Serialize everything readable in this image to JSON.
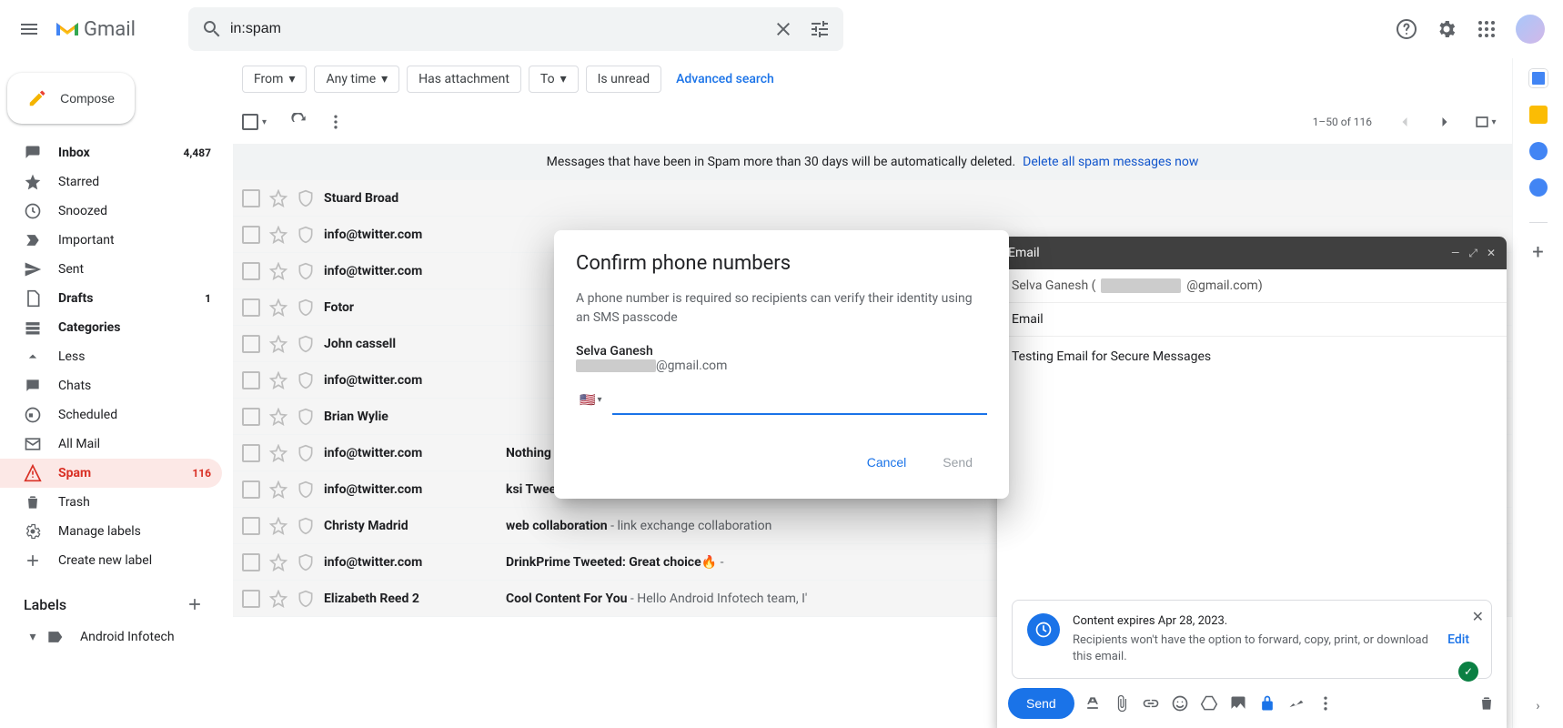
{
  "header": {
    "logo_text": "Gmail",
    "search_value": "in:spam"
  },
  "sidebar": {
    "compose_label": "Compose",
    "items": [
      {
        "label": "Inbox",
        "count": "4,487",
        "bold": true
      },
      {
        "label": "Starred"
      },
      {
        "label": "Snoozed"
      },
      {
        "label": "Important"
      },
      {
        "label": "Sent"
      },
      {
        "label": "Drafts",
        "count": "1",
        "bold": true
      },
      {
        "label": "Categories",
        "bold": true
      },
      {
        "label": "Less"
      },
      {
        "label": "Chats"
      },
      {
        "label": "Scheduled"
      },
      {
        "label": "All Mail"
      },
      {
        "label": "Spam",
        "count": "116",
        "active": true
      },
      {
        "label": "Trash"
      },
      {
        "label": "Manage labels"
      },
      {
        "label": "Create new label"
      }
    ],
    "labels_header": "Labels",
    "custom_labels": [
      {
        "label": "Android Infotech"
      }
    ]
  },
  "filters": {
    "from": "From",
    "any_time": "Any time",
    "has_attachment": "Has attachment",
    "to": "To",
    "is_unread": "Is unread",
    "advanced": "Advanced search"
  },
  "toolbar": {
    "page_text": "1–50 of 116"
  },
  "banner": {
    "text": "Messages that have been in Spam more than 30 days will be automatically deleted.",
    "link": "Delete all spam messages now"
  },
  "messages": [
    {
      "sender": "Stuard Broad",
      "subject": "",
      "snippet": ""
    },
    {
      "sender": "info@twitter.com",
      "subject": "",
      "snippet": ""
    },
    {
      "sender": "info@twitter.com",
      "subject": "",
      "snippet": ""
    },
    {
      "sender": "Fotor",
      "subject": "",
      "snippet": ""
    },
    {
      "sender": "John cassell",
      "subject": "",
      "snippet": ""
    },
    {
      "sender": "info@twitter.com",
      "subject": "",
      "snippet": ""
    },
    {
      "sender": "Brian Wylie",
      "subject": "",
      "snippet": ""
    },
    {
      "sender": "info@twitter.com",
      "subject": "Nothing Tweeted: This is the Glyph Interface. Eleva",
      "snippet": ""
    },
    {
      "sender": "info@twitter.com",
      "subject": "ksi Tweeted: Well, if that mean Jake won't have an o",
      "snippet": ""
    },
    {
      "sender": "Christy Madrid",
      "subject": "web collaboration",
      "snippet": " -  link exchange collaboration"
    },
    {
      "sender": "info@twitter.com",
      "subject": "DrinkPrime Tweeted: Great choice🔥",
      "snippet": " - "
    },
    {
      "sender": "Elizabeth Reed",
      "sender_suffix": " 2",
      "subject": "Cool Content For You",
      "snippet": " -  Hello Android Infotech team, I'"
    }
  ],
  "compose": {
    "title": "Email",
    "to_prefix": "Selva Ganesh (",
    "to_suffix": "@gmail.com)",
    "subject": "Email",
    "body": "Testing Email for Secure Messages",
    "confidential": {
      "title": "Content expires Apr 28, 2023.",
      "desc": "Recipients won't have the option to forward, copy, print, or download this email.",
      "edit": "Edit"
    },
    "send": "Send"
  },
  "modal": {
    "title": "Confirm phone numbers",
    "desc": "A phone number is required so recipients can verify their identity using an SMS passcode",
    "name": "Selva Ganesh",
    "email_suffix": "@gmail.com",
    "cancel": "Cancel",
    "send": "Send"
  }
}
